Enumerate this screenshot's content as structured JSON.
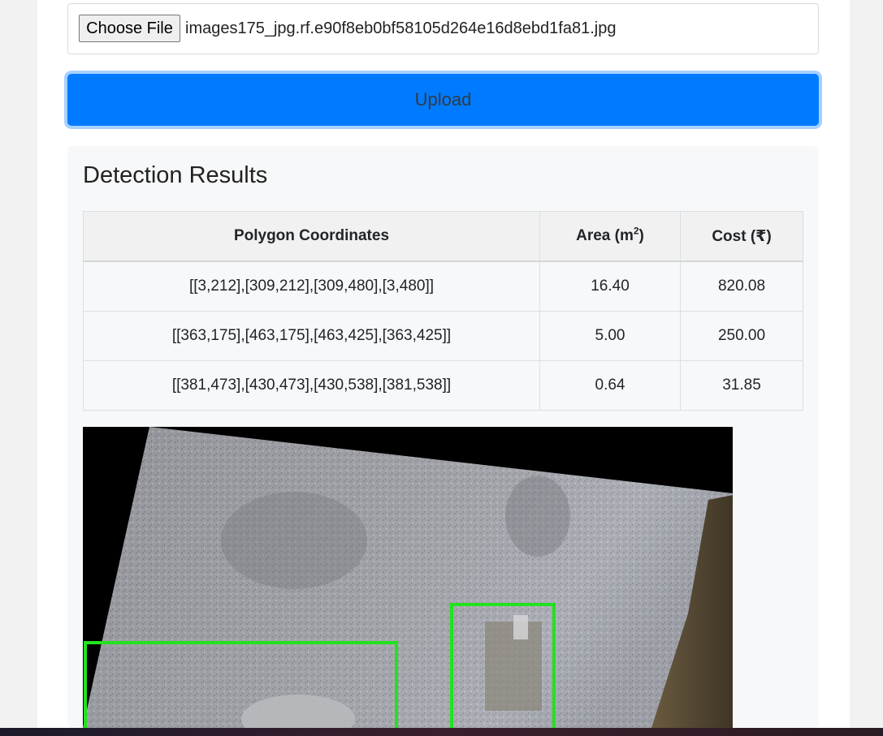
{
  "file_input": {
    "button_label": "Choose File",
    "file_name": "images175_jpg.rf.e90f8eb0bf58105d264e16d8ebd1fa81.jpg"
  },
  "upload": {
    "label": "Upload"
  },
  "results": {
    "title": "Detection Results",
    "headers": {
      "coords": "Polygon Coordinates",
      "area_prefix": "Area (m",
      "area_sup": "2",
      "area_suffix": ")",
      "cost": "Cost (₹)"
    },
    "rows": [
      {
        "coords": "[[3,212],[309,212],[309,480],[3,480]]",
        "area": "16.40",
        "cost": "820.08"
      },
      {
        "coords": "[[363,175],[463,175],[463,425],[363,425]]",
        "area": "5.00",
        "cost": "250.00"
      },
      {
        "coords": "[[381,473],[430,473],[430,538],[381,538]]",
        "area": "0.64",
        "cost": "31.85"
      }
    ]
  },
  "colors": {
    "primary": "#007bff",
    "detection_box": "#22e21f"
  }
}
